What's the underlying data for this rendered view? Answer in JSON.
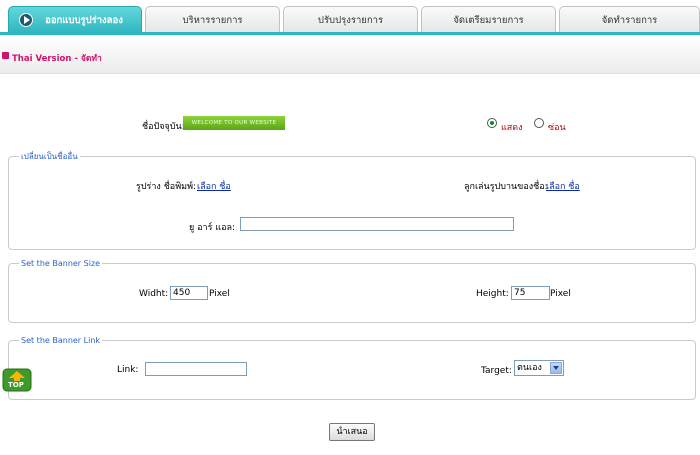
{
  "tabs": [
    {
      "label": "ออกแบบรูปร่างลอง",
      "active": true
    },
    {
      "label": "บริหารรายการ"
    },
    {
      "label": "ปรับปรุงรายการ"
    },
    {
      "label": "จัดเตรียมรายการ"
    },
    {
      "label": "จัดทำรายการ"
    }
  ],
  "subbar": {
    "title": "Thai Version - จัดทำ"
  },
  "current": {
    "label": "ชื่อปัจจุบัน:",
    "badge": "WELCOME TO OUR WEBSITE",
    "radio_show": "แสดง",
    "radio_hide": "ซ่อน",
    "selected": "show"
  },
  "rename": {
    "legend": "เปลี่ยนเป็นชื่ออื่น",
    "shape_label": "รูปร่าง ชื่อพิมพ์:",
    "shape_link": "เลือก ชื่อ",
    "pattern_label": "ลูกเล่นรูปบานของชื่อ:",
    "pattern_link": "เลือก ชื่อ",
    "url_label": "ยู อาร์ แอล:",
    "url_value": ""
  },
  "size": {
    "legend": "Set the Banner Size",
    "width_label": "Widht:",
    "width_value": "450",
    "width_unit": "Pixel",
    "height_label": "Height:",
    "height_value": "75",
    "height_unit": "Pixel"
  },
  "link": {
    "legend": "Set the Banner Link",
    "link_label": "Link:",
    "link_value": "",
    "target_label": "Target:",
    "target_value": "ตนเอง"
  },
  "top_badge": "TOP",
  "submit_label": "นำเสนอ",
  "colors": {
    "accent": "#2fb7bf",
    "subtitle": "#d0146b",
    "legend": "#2a63c7"
  }
}
